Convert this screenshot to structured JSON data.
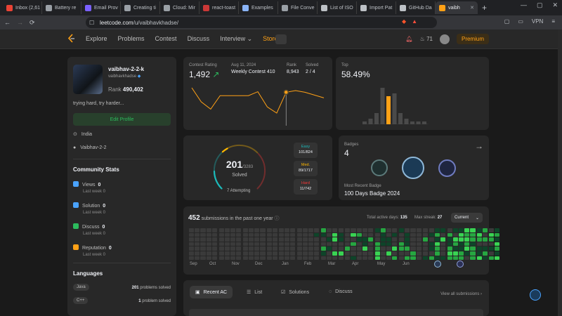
{
  "browser": {
    "tabs": [
      {
        "label": "Inbox (2,61",
        "color": "#ea4335"
      },
      {
        "label": "Battery re",
        "color": "#9aa0a6"
      },
      {
        "label": "Email Prov",
        "color": "#7b61ff"
      },
      {
        "label": "Creating ti",
        "color": "#9aa0a6"
      },
      {
        "label": "Cloud: Mir",
        "color": "#9aa0a6"
      },
      {
        "label": "react-toast",
        "color": "#cb3837"
      },
      {
        "label": "Examples",
        "color": "#8ab4f8"
      },
      {
        "label": "File Conve",
        "color": "#9aa0a6"
      },
      {
        "label": "List of ISO",
        "color": "#bdc1c6"
      },
      {
        "label": "Import Pat",
        "color": "#bdc1c6"
      },
      {
        "label": "GitHub Da",
        "color": "#bdc1c6"
      }
    ],
    "active_tab": "vaibh",
    "url_host": "leetcode.com",
    "url_path": "/u/vaibhavkhadse/",
    "vpn": "VPN"
  },
  "nav": {
    "links": [
      "Explore",
      "Problems",
      "Contest",
      "Discuss",
      "Interview ⌄"
    ],
    "store": "Store ⌄",
    "streak": "71",
    "premium": "Premium"
  },
  "profile": {
    "name": "vaibhav-2-2-k",
    "username": "vaibhavkhadse",
    "rank_label": "Rank",
    "rank": "490,402",
    "bio": "trying hard, try harder...",
    "edit": "Edit Profile",
    "location": "India",
    "github": "Vaibhav-2-2"
  },
  "community": {
    "title": "Community Stats",
    "items": [
      {
        "label": "Views",
        "value": "0",
        "sub": "Last week 0",
        "color": "#4aa3ff"
      },
      {
        "label": "Solution",
        "value": "0",
        "sub": "Last week 0",
        "color": "#4aa3ff"
      },
      {
        "label": "Discuss",
        "value": "0",
        "sub": "Last week 0",
        "color": "#2cbb5d"
      },
      {
        "label": "Reputation",
        "value": "0",
        "sub": "Last week 0",
        "color": "#ffa116"
      }
    ]
  },
  "languages": {
    "title": "Languages",
    "items": [
      {
        "name": "Java",
        "count": "201",
        "suffix": " problems solved"
      },
      {
        "name": "C++",
        "count": "1",
        "suffix": " problem solved"
      }
    ]
  },
  "contest": {
    "rating_label": "Contest Rating",
    "rating": "1,492",
    "date": "Aug 11, 2024",
    "name": "Weekly Contest 410",
    "rank_label": "Rank",
    "rank": "8,943",
    "solved_label": "Solved",
    "solved": "2 / 4",
    "ratings": [
      1500,
      1475,
      1462,
      1486,
      1486,
      1486,
      1486,
      1493,
      1466,
      1455,
      1492,
      1495,
      1492,
      1487,
      1482
    ],
    "highlight_index": 10,
    "top_label": "Top",
    "top_pct": "58.49%",
    "hist": [
      1,
      2,
      4,
      13,
      10,
      11,
      4,
      2,
      1,
      1,
      1
    ],
    "hist_highlight": 4
  },
  "solved": {
    "count": "201",
    "total": "/3283",
    "label": "Solved",
    "attempting": "7 Attempting",
    "fraction": 0.061,
    "easy": {
      "label": "Easy",
      "value": "101/824",
      "color": "#1cbaba"
    },
    "medium": {
      "label": "Med.",
      "value": "89/1717",
      "color": "#ffb700"
    },
    "hard": {
      "label": "Hard",
      "value": "11/742",
      "color": "#f63737"
    }
  },
  "badges": {
    "label": "Badges",
    "count": "4",
    "recent_label": "Most Recent Badge",
    "recent": "100 Days Badge 2024"
  },
  "submissions": {
    "count": "452",
    "label": "submissions in the past one year",
    "active_label": "Total active days:",
    "active": "135",
    "streak_label": "Max streak:",
    "streak": "27",
    "dropdown": "Current",
    "months": [
      "Sep",
      "Oct",
      "Nov",
      "Dec",
      "Jan",
      "Feb",
      "Mar",
      "Apr",
      "May",
      "Jun"
    ]
  },
  "recent": {
    "tabs": [
      "Recent AC",
      "List",
      "Solutions",
      "Discuss"
    ],
    "view_all": "View all submissions"
  }
}
